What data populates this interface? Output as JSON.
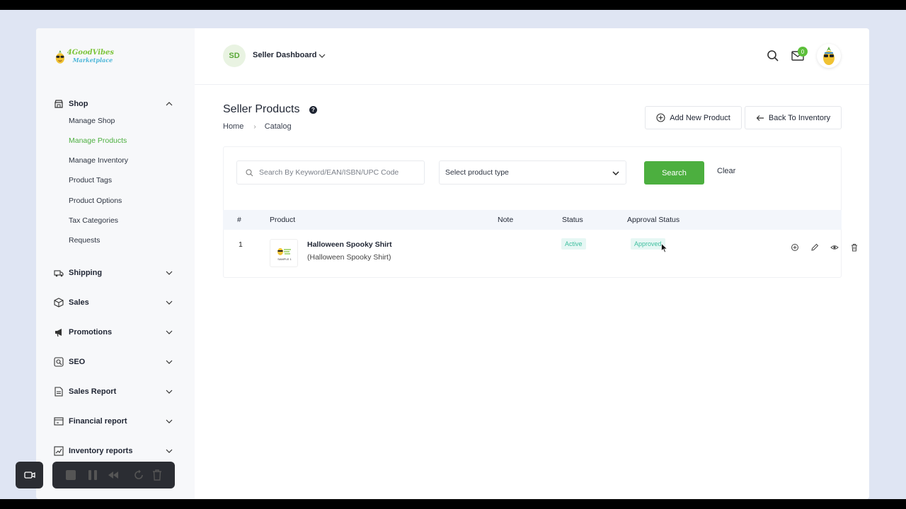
{
  "logo": {
    "line1": "4GoodVibes",
    "line2": "Marketplace"
  },
  "sidebar": {
    "groups": [
      {
        "label": "Shop",
        "icon": "shop-icon",
        "expanded": true
      },
      {
        "label": "Shipping",
        "icon": "truck-icon"
      },
      {
        "label": "Sales",
        "icon": "box-icon"
      },
      {
        "label": "Promotions",
        "icon": "megaphone-icon"
      },
      {
        "label": "SEO",
        "icon": "seo-icon"
      },
      {
        "label": "Sales Report",
        "icon": "report-icon"
      },
      {
        "label": "Financial report",
        "icon": "finance-icon"
      },
      {
        "label": "Inventory reports",
        "icon": "chart-icon"
      }
    ],
    "shop_items": [
      "Manage Shop",
      "Manage Products",
      "Manage Inventory",
      "Product Tags",
      "Product Options",
      "Tax Categories",
      "Requests"
    ],
    "active_item": "Manage Products"
  },
  "header": {
    "badge": "SD",
    "title": "Seller Dashboard",
    "mail_count": "0"
  },
  "page": {
    "title": "Seller Products",
    "help": "?",
    "breadcrumb": [
      "Home",
      "Catalog"
    ],
    "add_button": "Add New Product",
    "back_button": "Back To Inventory"
  },
  "filters": {
    "search_placeholder": "Search By Keyword/EAN/ISBN/UPC Code",
    "select_value": "Select product type",
    "search_button": "Search",
    "clear_button": "Clear"
  },
  "table": {
    "columns": [
      "#",
      "Product",
      "Note",
      "Status",
      "Approval Status"
    ],
    "rows": [
      {
        "num": "1",
        "name": "Halloween Spooky Shirt",
        "subtitle": "(Halloween Spooky Shirt)",
        "note": "",
        "status": "Active",
        "approval": "Approved",
        "thumb_label": "SAMPLE 1"
      }
    ]
  },
  "colors": {
    "accent": "#4caf3f",
    "status_bg": "#e6f7f4",
    "status_text": "#3fbf9f"
  }
}
